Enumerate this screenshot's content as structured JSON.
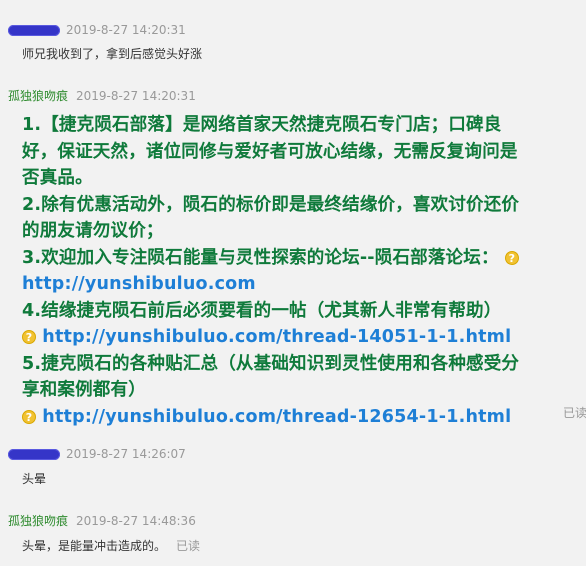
{
  "messages": [
    {
      "time": "2019-8-27 14:20:31",
      "text": "师兄我收到了，拿到后感觉头好涨"
    },
    {
      "sender": "孤独狼吻痕",
      "time": "2019-8-27 14:20:31",
      "lines": {
        "l1": "1.【捷克陨石部落】是网络首家天然捷克陨石专门店；口碑良",
        "l2": "好，保证天然，诸位同修与爱好者可放心结缘，无需反复询问是",
        "l3": "否真品。",
        "l4": "2.除有优惠活动外，陨石的标价即是最终结缘价，喜欢讨价还价",
        "l5": "的朋友请勿议价；",
        "l6": "3.欢迎加入专注陨石能量与灵性探索的论坛--陨石部落论坛：",
        "l7_link": "http://yunshibuluo.com",
        "l8": "4.结缘捷克陨石前后必须要看的一帖（尤其新人非常有帮助）",
        "l9_link": "http://yunshibuluo.com/thread-14051-1-1.html",
        "l10": "5.捷克陨石的各种贴汇总（从基础知识到灵性使用和各种感受分",
        "l11": "享和案例都有）",
        "l12_link": "http://yunshibuluo.com/thread-12654-1-1.html"
      },
      "read_status": "已读"
    },
    {
      "time": "2019-8-27 14:26:07",
      "text": "头晕"
    },
    {
      "sender": "孤独狼吻痕",
      "time": "2019-8-27 14:48:36",
      "text": "头晕，是能量冲击造成的。",
      "read_status": "已读"
    }
  ],
  "icons": {
    "question": "?"
  }
}
